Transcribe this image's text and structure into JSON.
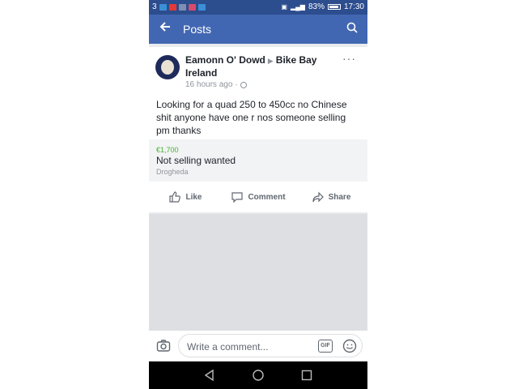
{
  "status_bar": {
    "notification_count": "3",
    "battery": "83%",
    "time": "17:30",
    "bg_color": "#2c4d8e"
  },
  "nav": {
    "back_icon": "arrow-left-icon",
    "title": "Posts",
    "search_icon": "search-icon",
    "bg_color": "#4267b2"
  },
  "post": {
    "author": "Eamonn O' Dowd",
    "group_arrow": "▶",
    "group": "Bike Bay Ireland",
    "more": "···",
    "time": "16 hours ago",
    "separator": "·",
    "privacy_icon": "globe-icon",
    "body": "Looking for a quad 250 to 450cc no Chinese shit anyone have one r nos someone selling pm thanks",
    "sale": {
      "price": "€1,700",
      "item": "Not selling wanted",
      "location": "Drogheda",
      "price_color": "#42b72a"
    },
    "actions": {
      "like": "Like",
      "comment": "Comment",
      "share": "Share"
    }
  },
  "comment_bar": {
    "placeholder": "Write a comment...",
    "gif": "GIF"
  }
}
